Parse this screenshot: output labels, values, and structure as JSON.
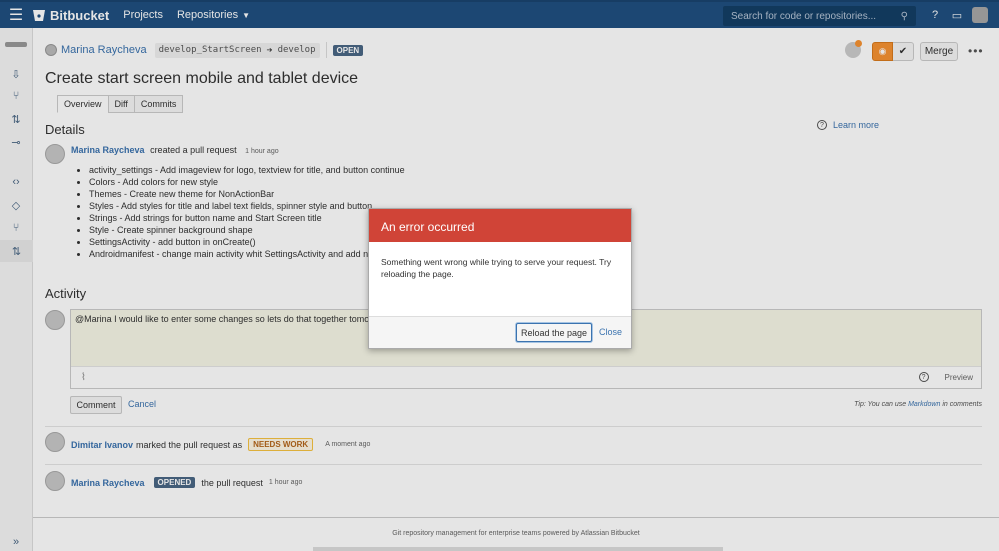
{
  "topbar": {
    "brand": "Bitbucket",
    "nav": [
      "Projects",
      "Repositories"
    ],
    "search_placeholder": "Search for code or repositories..."
  },
  "pr": {
    "author": "Marina Raycheva",
    "source_branch": "develop_StartScreen",
    "target_branch": "develop",
    "status": "OPEN",
    "merge_label": "Merge",
    "title": "Create start screen mobile and tablet device",
    "tabs": [
      "Overview",
      "Diff",
      "Commits"
    ]
  },
  "details": {
    "heading": "Details",
    "learn_more": "Learn more",
    "created_by": "Marina Raycheva",
    "created_action": "created a pull request",
    "created_time": "1 hour ago",
    "items": [
      "activity_settings - Add imageview for logo, textview for title, and button continue",
      "Colors - Add colors for new style",
      "Themes - Create new theme for NonActionBar",
      "Styles - Add styles for title and label text fields, spinner style and button",
      "Strings - Add strings for button name and Start Screen title",
      "Style - Create spinner background shape",
      "SettingsActivity - add button in onCreate()",
      "Androidmanifest - change main activity whit SettingsActivity and add new"
    ]
  },
  "activity": {
    "heading": "Activity",
    "draft_comment": "@Marina I would like to enter some changes so lets do that together tomorrow",
    "preview_label": "Preview",
    "comment_button": "Comment",
    "cancel_link": "Cancel",
    "tip_prefix": "Tip: You can use ",
    "tip_markdown": "Markdown",
    "tip_suffix": " in comments",
    "events": [
      {
        "who": "Dimitar Ivanov",
        "action": "marked the pull request as",
        "badge": "NEEDS WORK",
        "time": "A moment ago"
      },
      {
        "who": "Marina Raycheva",
        "badge": "OPENED",
        "action": "the pull request",
        "time": "1 hour ago"
      }
    ]
  },
  "footer": {
    "text": "Git repository management for enterprise teams powered by Atlassian Bitbucket"
  },
  "dialog": {
    "title": "An error occurred",
    "message": "Something went wrong while trying to serve your request. Try reloading the page.",
    "reload_button": "Reload the page",
    "close_link": "Close"
  },
  "colors": {
    "topbar": "#205081",
    "error_header": "#d04437",
    "link": "#3b73af",
    "needs_work": "#f79232"
  }
}
